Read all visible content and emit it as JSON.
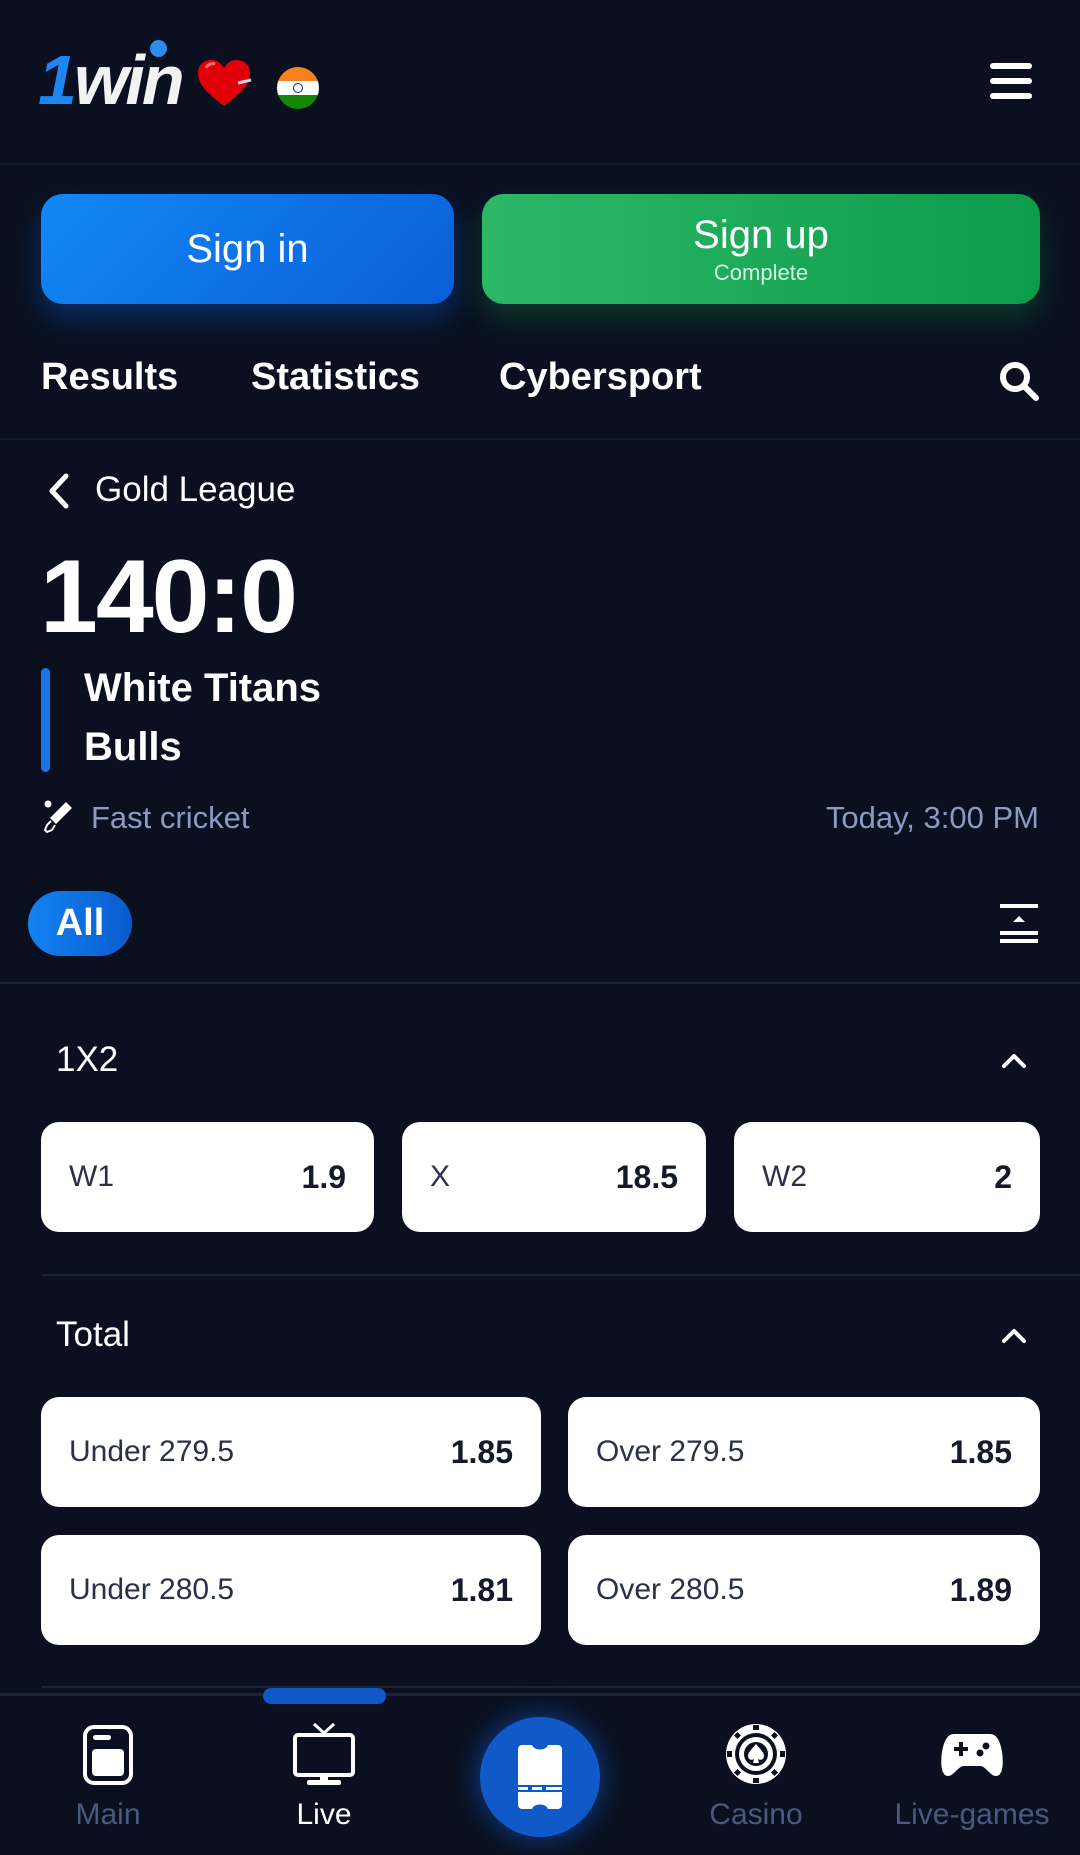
{
  "header": {
    "logo_text_one": "1",
    "logo_text_win": "win",
    "country_flag": "india-flag",
    "menu_icon": "hamburger-menu-icon"
  },
  "auth": {
    "signin_label": "Sign in",
    "signup_label": "Sign up",
    "signup_sub": "Complete"
  },
  "nav": {
    "items": [
      {
        "label": "Results"
      },
      {
        "label": "Statistics"
      },
      {
        "label": "Cybersport"
      }
    ],
    "search_icon": "search-icon"
  },
  "match": {
    "league": "Gold League",
    "score": "140:0",
    "team1": "White Titans",
    "team2": "Bulls",
    "sport": "Fast cricket",
    "datetime": "Today, 3:00 PM",
    "active_team_color": "#1a74e6"
  },
  "filters": {
    "active": "All"
  },
  "markets": [
    {
      "title": "1X2",
      "outcomes": [
        {
          "label": "W1",
          "odds": "1.9"
        },
        {
          "label": "X",
          "odds": "18.5"
        },
        {
          "label": "W2",
          "odds": "2"
        }
      ]
    },
    {
      "title": "Total",
      "outcomes": [
        {
          "label": "Under 279.5",
          "odds": "1.85"
        },
        {
          "label": "Over 279.5",
          "odds": "1.85"
        },
        {
          "label": "Under 280.5",
          "odds": "1.81"
        },
        {
          "label": "Over 280.5",
          "odds": "1.89"
        }
      ]
    }
  ],
  "bottom_nav": {
    "items": [
      {
        "label": "Main",
        "icon": "main-icon",
        "active": false
      },
      {
        "label": "Live",
        "icon": "tv-icon",
        "active": true
      },
      {
        "label": "",
        "icon": "bet-slip-ticket-icon",
        "active": false
      },
      {
        "label": "Casino",
        "icon": "casino-chip-icon",
        "active": false
      },
      {
        "label": "Live-games",
        "icon": "gamepad-icon",
        "active": false
      }
    ]
  },
  "colors": {
    "background": "#0a101f",
    "primary_blue": "#1288f5",
    "signup_green": "#1eab5a",
    "muted_text": "#8a9ac1"
  }
}
